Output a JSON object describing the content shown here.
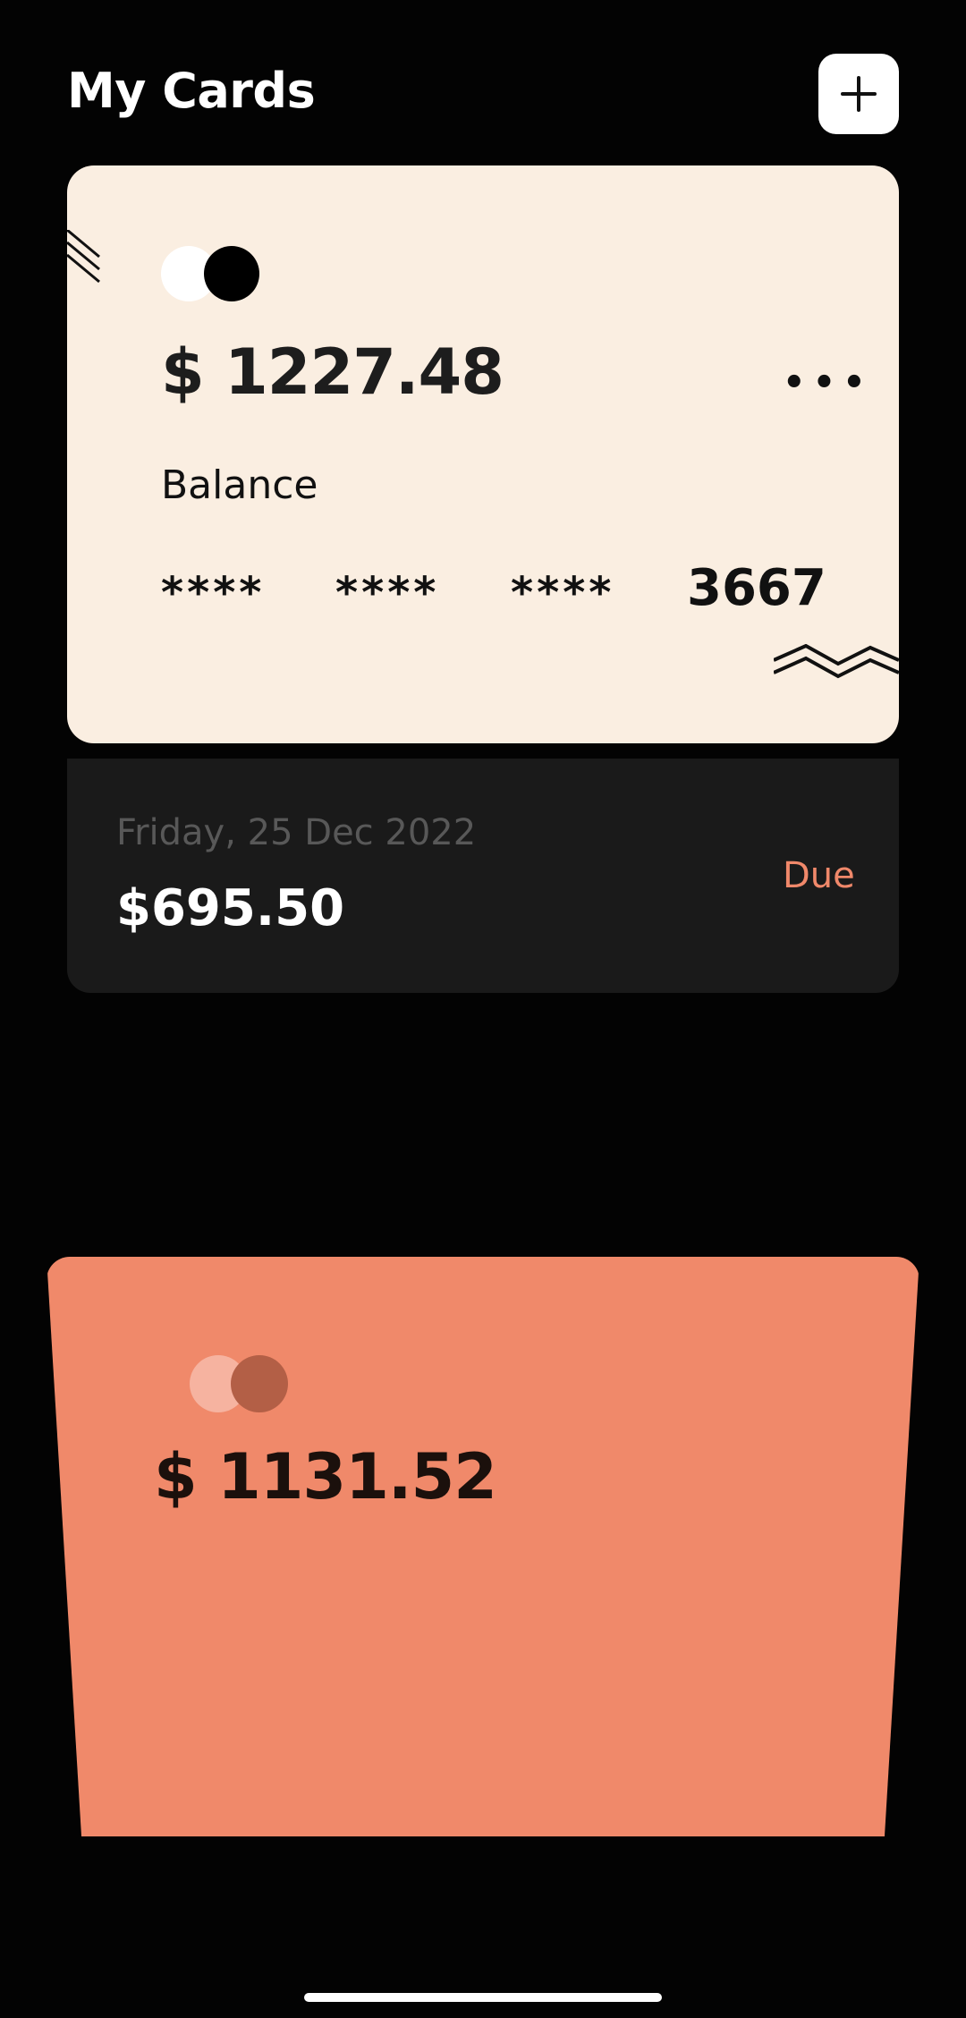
{
  "header": {
    "title": "My Cards",
    "add_icon": "plus-icon"
  },
  "cards": [
    {
      "logo_icon": "card-network-logo",
      "amount": "$ 1227.48",
      "menu_icon": "more-horizontal-icon",
      "balance_label": "Balance",
      "number_masked": [
        "****",
        "****",
        "****"
      ],
      "number_last4": "3667",
      "background": "#faeee1"
    },
    {
      "logo_icon": "card-network-logo",
      "amount": "$ 1131.52",
      "background": "#f0896a"
    }
  ],
  "due": {
    "date": "Friday, 25 Dec 2022",
    "amount": "$695.50",
    "label": "Due",
    "label_color": "#f0886a"
  }
}
